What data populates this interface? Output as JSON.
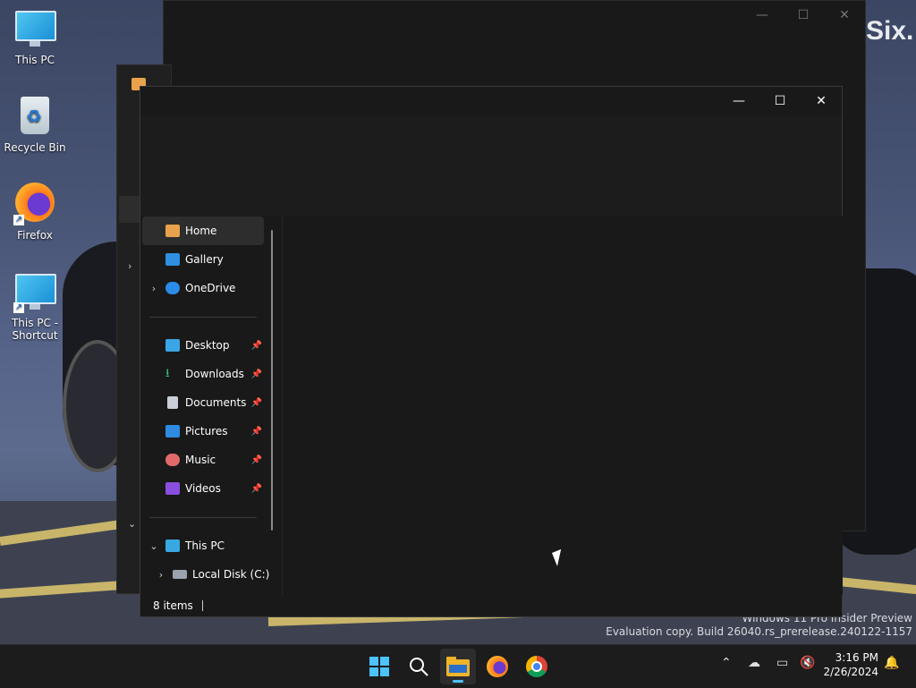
{
  "desktop": {
    "brand_text": "Six.",
    "icons": [
      {
        "label": "This PC",
        "icon": "monitor-icon"
      },
      {
        "label": "Recycle Bin",
        "icon": "recycle-bin-icon"
      },
      {
        "label": "Firefox",
        "icon": "firefox-icon"
      },
      {
        "label": "This PC - Shortcut",
        "icon": "monitor-shortcut-icon"
      }
    ],
    "watermark_line1": "Windows 11 Pro Insider Preview",
    "watermark_line2": "Evaluation copy. Build 26040.rs_prerelease.240122-1157"
  },
  "explorer": {
    "caption": {
      "minimize": "—",
      "maximize": "☐",
      "close": "✕"
    },
    "nav": {
      "home": "Home",
      "gallery": "Gallery",
      "onedrive": "OneDrive",
      "desktop": "Desktop",
      "downloads": "Downloads",
      "documents": "Documents",
      "pictures": "Pictures",
      "music": "Music",
      "videos": "Videos",
      "this_pc": "This PC",
      "local_disk": "Local Disk (C:)"
    },
    "status": {
      "items": "8 items"
    }
  },
  "taskbar": {
    "apps": [
      "start-icon",
      "search-icon",
      "file-explorer-icon",
      "firefox-icon",
      "chrome-icon"
    ],
    "time": "3:16 PM",
    "date": "2/26/2024"
  },
  "colors": {
    "accent": "#4cc2ff",
    "window_bg": "#191919",
    "taskbar_bg": "#1c1c1c"
  }
}
